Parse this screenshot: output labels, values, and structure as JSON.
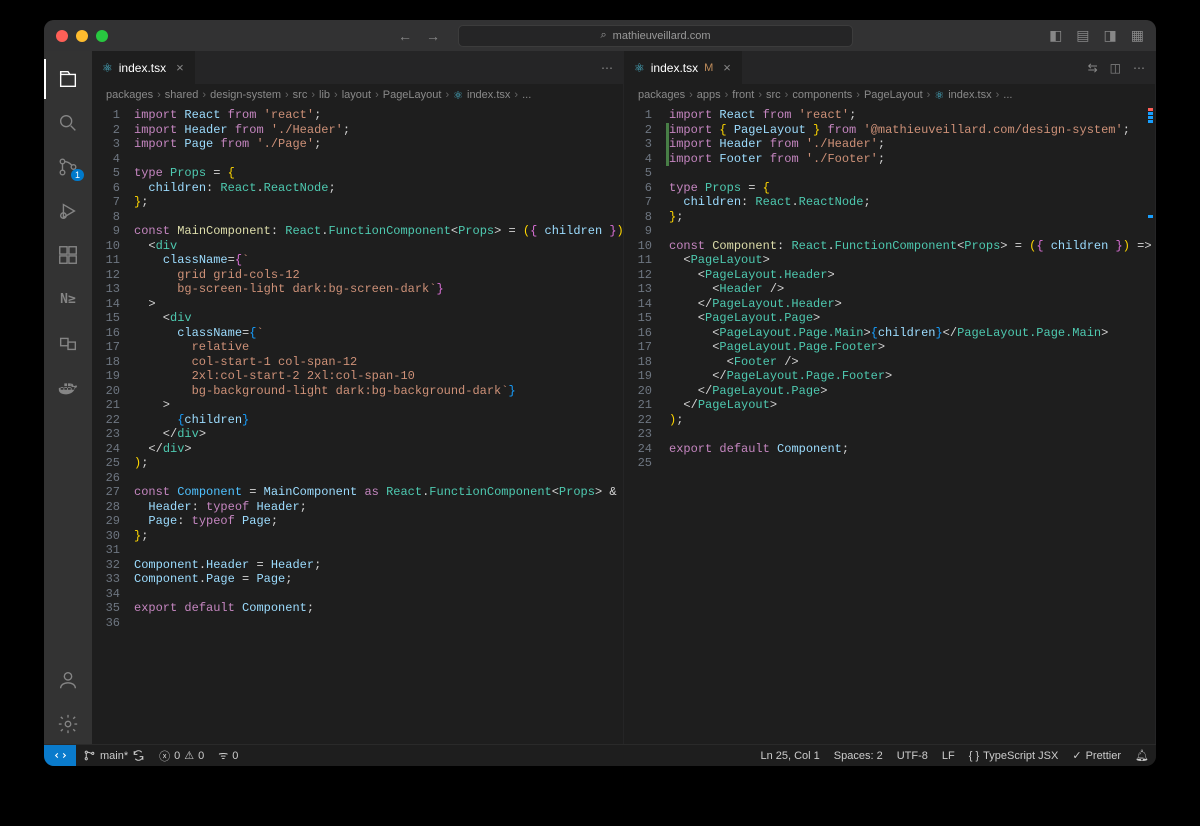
{
  "titlebar": {
    "url": "mathieuveillard.com"
  },
  "activity": {
    "scm_badge": "1"
  },
  "leftEditor": {
    "tab": {
      "name": "index.tsx"
    },
    "breadcrumbs": [
      "packages",
      "shared",
      "design-system",
      "src",
      "lib",
      "layout",
      "PageLayout",
      "index.tsx",
      "..."
    ],
    "lines": [
      [
        [
          "kw",
          "import"
        ],
        [
          "punct",
          " "
        ],
        [
          "var",
          "React"
        ],
        [
          "punct",
          " "
        ],
        [
          "kw",
          "from"
        ],
        [
          "punct",
          " "
        ],
        [
          "str",
          "'react'"
        ],
        [
          "punct",
          ";"
        ]
      ],
      [
        [
          "kw",
          "import"
        ],
        [
          "punct",
          " "
        ],
        [
          "var",
          "Header"
        ],
        [
          "punct",
          " "
        ],
        [
          "kw",
          "from"
        ],
        [
          "punct",
          " "
        ],
        [
          "str",
          "'./Header'"
        ],
        [
          "punct",
          ";"
        ]
      ],
      [
        [
          "kw",
          "import"
        ],
        [
          "punct",
          " "
        ],
        [
          "var",
          "Page"
        ],
        [
          "punct",
          " "
        ],
        [
          "kw",
          "from"
        ],
        [
          "punct",
          " "
        ],
        [
          "str",
          "'./Page'"
        ],
        [
          "punct",
          ";"
        ]
      ],
      [],
      [
        [
          "kw",
          "type"
        ],
        [
          "punct",
          " "
        ],
        [
          "type",
          "Props"
        ],
        [
          "punct",
          " "
        ],
        [
          "op",
          "="
        ],
        [
          "punct",
          " "
        ],
        [
          "brace",
          "{"
        ]
      ],
      [
        [
          "punct",
          "  "
        ],
        [
          "prop",
          "children"
        ],
        [
          "op",
          ":"
        ],
        [
          "punct",
          " "
        ],
        [
          "type",
          "React"
        ],
        [
          "punct",
          "."
        ],
        [
          "type",
          "ReactNode"
        ],
        [
          "punct",
          ";"
        ]
      ],
      [
        [
          "brace",
          "}"
        ],
        [
          "punct",
          ";"
        ]
      ],
      [],
      [
        [
          "kw",
          "const"
        ],
        [
          "punct",
          " "
        ],
        [
          "func",
          "MainComponent"
        ],
        [
          "op",
          ":"
        ],
        [
          "punct",
          " "
        ],
        [
          "type",
          "React"
        ],
        [
          "punct",
          "."
        ],
        [
          "type",
          "FunctionComponent"
        ],
        [
          "punct",
          "<"
        ],
        [
          "type",
          "Props"
        ],
        [
          "punct",
          ">"
        ],
        [
          "punct",
          " "
        ],
        [
          "op",
          "="
        ],
        [
          "punct",
          " "
        ],
        [
          "brace",
          "("
        ],
        [
          "pbrace",
          "{"
        ],
        [
          "punct",
          " "
        ],
        [
          "var",
          "children"
        ],
        [
          "punct",
          " "
        ],
        [
          "pbrace",
          "}"
        ],
        [
          "brace",
          ")"
        ],
        [
          "punct",
          " "
        ],
        [
          "op",
          "=>"
        ],
        [
          "punct",
          " "
        ],
        [
          "brace",
          "("
        ]
      ],
      [
        [
          "punct",
          "  <"
        ],
        [
          "tag",
          "div"
        ]
      ],
      [
        [
          "punct",
          "    "
        ],
        [
          "prop",
          "className"
        ],
        [
          "op",
          "="
        ],
        [
          "pbrace",
          "{"
        ],
        [
          "str",
          "`"
        ]
      ],
      [
        [
          "punct",
          "      "
        ],
        [
          "str",
          "grid grid-cols-12"
        ]
      ],
      [
        [
          "punct",
          "      "
        ],
        [
          "str",
          "bg-screen-light dark:bg-screen-dark`"
        ],
        [
          "pbrace",
          "}"
        ]
      ],
      [
        [
          "punct",
          "  >"
        ]
      ],
      [
        [
          "punct",
          "    <"
        ],
        [
          "tag",
          "div"
        ]
      ],
      [
        [
          "punct",
          "      "
        ],
        [
          "prop",
          "className"
        ],
        [
          "op",
          "="
        ],
        [
          "bbrace",
          "{"
        ],
        [
          "str",
          "`"
        ]
      ],
      [
        [
          "punct",
          "        "
        ],
        [
          "str",
          "relative"
        ]
      ],
      [
        [
          "punct",
          "        "
        ],
        [
          "str",
          "col-start-1 col-span-12"
        ]
      ],
      [
        [
          "punct",
          "        "
        ],
        [
          "str",
          "2xl:col-start-2 2xl:col-span-10"
        ]
      ],
      [
        [
          "punct",
          "        "
        ],
        [
          "str",
          "bg-background-light dark:bg-background-dark`"
        ],
        [
          "bbrace",
          "}"
        ]
      ],
      [
        [
          "punct",
          "    >"
        ]
      ],
      [
        [
          "punct",
          "      "
        ],
        [
          "bbrace",
          "{"
        ],
        [
          "var",
          "children"
        ],
        [
          "bbrace",
          "}"
        ]
      ],
      [
        [
          "punct",
          "    </"
        ],
        [
          "tag",
          "div"
        ],
        [
          "punct",
          ">"
        ]
      ],
      [
        [
          "punct",
          "  </"
        ],
        [
          "tag",
          "div"
        ],
        [
          "punct",
          ">"
        ]
      ],
      [
        [
          "brace",
          ")"
        ],
        [
          "punct",
          ";"
        ]
      ],
      [],
      [
        [
          "kw",
          "const"
        ],
        [
          "punct",
          " "
        ],
        [
          "const",
          "Component"
        ],
        [
          "punct",
          " "
        ],
        [
          "op",
          "="
        ],
        [
          "punct",
          " "
        ],
        [
          "var",
          "MainComponent"
        ],
        [
          "punct",
          " "
        ],
        [
          "kw",
          "as"
        ],
        [
          "punct",
          " "
        ],
        [
          "type",
          "React"
        ],
        [
          "punct",
          "."
        ],
        [
          "type",
          "FunctionComponent"
        ],
        [
          "punct",
          "<"
        ],
        [
          "type",
          "Props"
        ],
        [
          "punct",
          ">"
        ],
        [
          "punct",
          " "
        ],
        [
          "op",
          "&"
        ],
        [
          "punct",
          " "
        ],
        [
          "brace",
          "{"
        ]
      ],
      [
        [
          "punct",
          "  "
        ],
        [
          "prop",
          "Header"
        ],
        [
          "op",
          ":"
        ],
        [
          "punct",
          " "
        ],
        [
          "kw",
          "typeof"
        ],
        [
          "punct",
          " "
        ],
        [
          "var",
          "Header"
        ],
        [
          "punct",
          ";"
        ]
      ],
      [
        [
          "punct",
          "  "
        ],
        [
          "prop",
          "Page"
        ],
        [
          "op",
          ":"
        ],
        [
          "punct",
          " "
        ],
        [
          "kw",
          "typeof"
        ],
        [
          "punct",
          " "
        ],
        [
          "var",
          "Page"
        ],
        [
          "punct",
          ";"
        ]
      ],
      [
        [
          "brace",
          "}"
        ],
        [
          "punct",
          ";"
        ]
      ],
      [],
      [
        [
          "var",
          "Component"
        ],
        [
          "punct",
          "."
        ],
        [
          "var",
          "Header"
        ],
        [
          "punct",
          " "
        ],
        [
          "op",
          "="
        ],
        [
          "punct",
          " "
        ],
        [
          "var",
          "Header"
        ],
        [
          "punct",
          ";"
        ]
      ],
      [
        [
          "var",
          "Component"
        ],
        [
          "punct",
          "."
        ],
        [
          "var",
          "Page"
        ],
        [
          "punct",
          " "
        ],
        [
          "op",
          "="
        ],
        [
          "punct",
          " "
        ],
        [
          "var",
          "Page"
        ],
        [
          "punct",
          ";"
        ]
      ],
      [],
      [
        [
          "kw",
          "export"
        ],
        [
          "punct",
          " "
        ],
        [
          "kw",
          "default"
        ],
        [
          "punct",
          " "
        ],
        [
          "var",
          "Component"
        ],
        [
          "punct",
          ";"
        ]
      ],
      []
    ]
  },
  "rightEditor": {
    "tab": {
      "name": "index.tsx",
      "modified": "M"
    },
    "breadcrumbs": [
      "packages",
      "apps",
      "front",
      "src",
      "components",
      "PageLayout",
      "index.tsx",
      "..."
    ],
    "diffMarks": {
      "2": "add",
      "3": "add",
      "4": "add"
    },
    "lines": [
      [
        [
          "kw",
          "import"
        ],
        [
          "punct",
          " "
        ],
        [
          "var",
          "React"
        ],
        [
          "punct",
          " "
        ],
        [
          "kw",
          "from"
        ],
        [
          "punct",
          " "
        ],
        [
          "str",
          "'react'"
        ],
        [
          "punct",
          ";"
        ]
      ],
      [
        [
          "kw",
          "import"
        ],
        [
          "punct",
          " "
        ],
        [
          "brace",
          "{"
        ],
        [
          "punct",
          " "
        ],
        [
          "var",
          "PageLayout"
        ],
        [
          "punct",
          " "
        ],
        [
          "brace",
          "}"
        ],
        [
          "punct",
          " "
        ],
        [
          "kw",
          "from"
        ],
        [
          "punct",
          " "
        ],
        [
          "str",
          "'@mathieuveillard.com/design-system'"
        ],
        [
          "punct",
          ";"
        ]
      ],
      [
        [
          "kw",
          "import"
        ],
        [
          "punct",
          " "
        ],
        [
          "var",
          "Header"
        ],
        [
          "punct",
          " "
        ],
        [
          "kw",
          "from"
        ],
        [
          "punct",
          " "
        ],
        [
          "str",
          "'./Header'"
        ],
        [
          "punct",
          ";"
        ]
      ],
      [
        [
          "kw",
          "import"
        ],
        [
          "punct",
          " "
        ],
        [
          "var",
          "Footer"
        ],
        [
          "punct",
          " "
        ],
        [
          "kw",
          "from"
        ],
        [
          "punct",
          " "
        ],
        [
          "str",
          "'./Footer'"
        ],
        [
          "punct",
          ";"
        ]
      ],
      [],
      [
        [
          "kw",
          "type"
        ],
        [
          "punct",
          " "
        ],
        [
          "type",
          "Props"
        ],
        [
          "punct",
          " "
        ],
        [
          "op",
          "="
        ],
        [
          "punct",
          " "
        ],
        [
          "brace",
          "{"
        ]
      ],
      [
        [
          "punct",
          "  "
        ],
        [
          "prop",
          "children"
        ],
        [
          "op",
          ":"
        ],
        [
          "punct",
          " "
        ],
        [
          "type",
          "React"
        ],
        [
          "punct",
          "."
        ],
        [
          "type",
          "ReactNode"
        ],
        [
          "punct",
          ";"
        ]
      ],
      [
        [
          "brace",
          "}"
        ],
        [
          "punct",
          ";"
        ]
      ],
      [],
      [
        [
          "kw",
          "const"
        ],
        [
          "punct",
          " "
        ],
        [
          "func",
          "Component"
        ],
        [
          "op",
          ":"
        ],
        [
          "punct",
          " "
        ],
        [
          "type",
          "React"
        ],
        [
          "punct",
          "."
        ],
        [
          "type",
          "FunctionComponent"
        ],
        [
          "punct",
          "<"
        ],
        [
          "type",
          "Props"
        ],
        [
          "punct",
          ">"
        ],
        [
          "punct",
          " "
        ],
        [
          "op",
          "="
        ],
        [
          "punct",
          " "
        ],
        [
          "brace",
          "("
        ],
        [
          "pbrace",
          "{"
        ],
        [
          "punct",
          " "
        ],
        [
          "var",
          "children"
        ],
        [
          "punct",
          " "
        ],
        [
          "pbrace",
          "}"
        ],
        [
          "brace",
          ")"
        ],
        [
          "punct",
          " "
        ],
        [
          "op",
          "=>"
        ],
        [
          "punct",
          " "
        ],
        [
          "brace",
          "("
        ]
      ],
      [
        [
          "punct",
          "  <"
        ],
        [
          "tag",
          "PageLayout"
        ],
        [
          "punct",
          ">"
        ]
      ],
      [
        [
          "punct",
          "    <"
        ],
        [
          "tag",
          "PageLayout.Header"
        ],
        [
          "punct",
          ">"
        ]
      ],
      [
        [
          "punct",
          "      <"
        ],
        [
          "tag",
          "Header"
        ],
        [
          "punct",
          " />"
        ]
      ],
      [
        [
          "punct",
          "    </"
        ],
        [
          "tag",
          "PageLayout.Header"
        ],
        [
          "punct",
          ">"
        ]
      ],
      [
        [
          "punct",
          "    <"
        ],
        [
          "tag",
          "PageLayout.Page"
        ],
        [
          "punct",
          ">"
        ]
      ],
      [
        [
          "punct",
          "      <"
        ],
        [
          "tag",
          "PageLayout.Page.Main"
        ],
        [
          "punct",
          ">"
        ],
        [
          "bbrace",
          "{"
        ],
        [
          "var",
          "children"
        ],
        [
          "bbrace",
          "}"
        ],
        [
          "punct",
          "</"
        ],
        [
          "tag",
          "PageLayout.Page.Main"
        ],
        [
          "punct",
          ">"
        ]
      ],
      [
        [
          "punct",
          "      <"
        ],
        [
          "tag",
          "PageLayout.Page.Footer"
        ],
        [
          "punct",
          ">"
        ]
      ],
      [
        [
          "punct",
          "        <"
        ],
        [
          "tag",
          "Footer"
        ],
        [
          "punct",
          " />"
        ]
      ],
      [
        [
          "punct",
          "      </"
        ],
        [
          "tag",
          "PageLayout.Page.Footer"
        ],
        [
          "punct",
          ">"
        ]
      ],
      [
        [
          "punct",
          "    </"
        ],
        [
          "tag",
          "PageLayout.Page"
        ],
        [
          "punct",
          ">"
        ]
      ],
      [
        [
          "punct",
          "  </"
        ],
        [
          "tag",
          "PageLayout"
        ],
        [
          "punct",
          ">"
        ]
      ],
      [
        [
          "brace",
          ")"
        ],
        [
          "punct",
          ";"
        ]
      ],
      [],
      [
        [
          "kw",
          "export"
        ],
        [
          "punct",
          " "
        ],
        [
          "kw",
          "default"
        ],
        [
          "punct",
          " "
        ],
        [
          "var",
          "Component"
        ],
        [
          "punct",
          ";"
        ]
      ],
      []
    ]
  },
  "statusbar": {
    "branch": "main*",
    "errors": "0",
    "warnings": "0",
    "ports": "0",
    "cursor": "Ln 25, Col 1",
    "spaces": "Spaces: 2",
    "encoding": "UTF-8",
    "eol": "LF",
    "lang": "TypeScript JSX",
    "prettier": "Prettier"
  }
}
